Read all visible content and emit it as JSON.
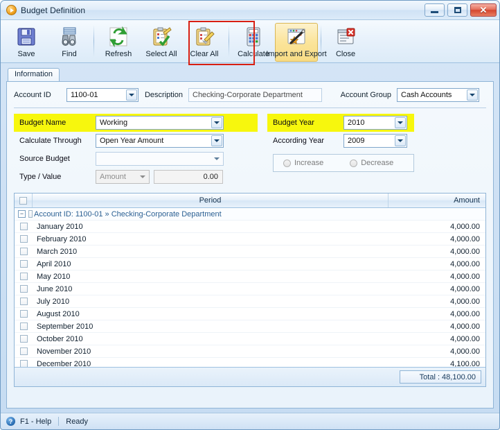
{
  "window": {
    "title": "Budget Definition",
    "app_icon": "play-circle-icon",
    "minimize_label": "Minimize",
    "maximize_label": "Maximize",
    "close_label": "Close"
  },
  "toolbar": {
    "buttons": [
      {
        "label": "Save",
        "icon": "floppy-disk-icon",
        "active": false
      },
      {
        "label": "Find",
        "icon": "binoculars-icon",
        "active": false
      },
      {
        "label": "Refresh",
        "icon": "refresh-arrows-icon",
        "active": false
      },
      {
        "label": "Select All",
        "icon": "clipboard-check-icon",
        "active": false
      },
      {
        "label": "Clear All",
        "icon": "clipboard-erase-icon",
        "active": false
      },
      {
        "label": "Calculate",
        "icon": "calculator-icon",
        "active": false
      },
      {
        "label": "Import and Export",
        "icon": "wand-window-icon",
        "active": true
      },
      {
        "label": "Close",
        "icon": "window-close-icon",
        "active": false
      }
    ]
  },
  "tabs": [
    {
      "label": "Information",
      "selected": true
    }
  ],
  "header_row": {
    "account_id_label": "Account ID",
    "account_id_value": "1100-01",
    "description_label": "Description",
    "description_value": "Checking-Corporate Department",
    "account_group_label": "Account Group",
    "account_group_value": "Cash Accounts"
  },
  "form": {
    "left": [
      {
        "label": "Budget Name",
        "value": "Working",
        "control": "select",
        "highlight": true,
        "disabled": false
      },
      {
        "label": "Calculate Through",
        "value": "Open Year Amount",
        "control": "select",
        "highlight": false,
        "disabled": false
      },
      {
        "label": "Source Budget",
        "value": "",
        "control": "select-flat",
        "highlight": false,
        "disabled": false
      },
      {
        "label": "Type / Value",
        "value": "Amount",
        "control": "type-value",
        "highlight": false,
        "disabled": true,
        "amount": "0.00"
      }
    ],
    "right": [
      {
        "label": "Budget Year",
        "value": "2010",
        "control": "select",
        "highlight": true
      },
      {
        "label": "According Year",
        "value": "2009",
        "control": "select",
        "highlight": false
      }
    ],
    "radios": [
      {
        "label": "Increase",
        "selected": false
      },
      {
        "label": "Decrease",
        "selected": false
      }
    ]
  },
  "grid": {
    "columns": [
      "",
      "Period",
      "Amount"
    ],
    "group_row": {
      "label": "Account ID: 1100-01 » Checking-Corporate Department",
      "expander": "−",
      "checked": false
    },
    "rows": [
      {
        "period": "January 2010",
        "amount": "4,000.00",
        "checked": false
      },
      {
        "period": "February 2010",
        "amount": "4,000.00",
        "checked": false
      },
      {
        "period": "March 2010",
        "amount": "4,000.00",
        "checked": false
      },
      {
        "period": "April 2010",
        "amount": "4,000.00",
        "checked": false
      },
      {
        "period": "May 2010",
        "amount": "4,000.00",
        "checked": false
      },
      {
        "period": "June 2010",
        "amount": "4,000.00",
        "checked": false
      },
      {
        "period": "July 2010",
        "amount": "4,000.00",
        "checked": false
      },
      {
        "period": "August 2010",
        "amount": "4,000.00",
        "checked": false
      },
      {
        "period": "September 2010",
        "amount": "4,000.00",
        "checked": false
      },
      {
        "period": "October 2010",
        "amount": "4,000.00",
        "checked": false
      },
      {
        "period": "November 2010",
        "amount": "4,000.00",
        "checked": false
      },
      {
        "period": "December 2010",
        "amount": "4,100.00",
        "checked": false
      }
    ],
    "total_label": "Total : 48,100.00"
  },
  "status": {
    "help": "F1 - Help",
    "help_icon": "question-circle-icon",
    "message": "Ready"
  },
  "colors": {
    "highlight": "#f7f70d",
    "annotation": "#d81f12",
    "active_toolbar": "#fbe49a",
    "frame": "#6f9bc4"
  }
}
